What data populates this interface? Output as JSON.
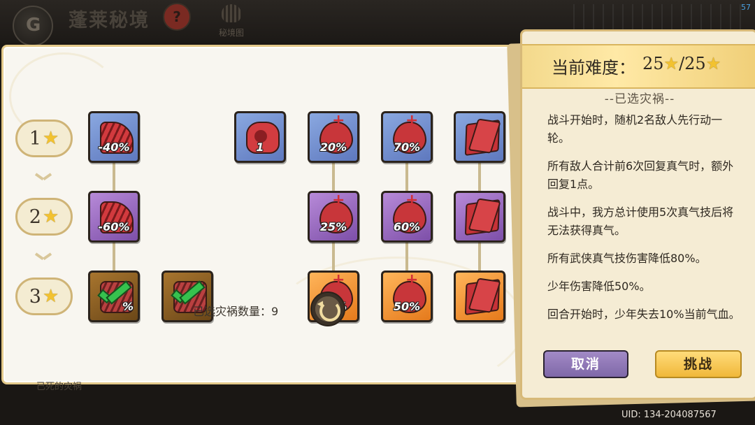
{
  "header": {
    "title": "蓬莱秘境",
    "map_label": "秘境图",
    "fps": "57"
  },
  "tiers": [
    {
      "label": "1",
      "star_icon": "star-icon"
    },
    {
      "label": "2",
      "star_icon": "star-icon"
    },
    {
      "label": "3",
      "star_icon": "star-icon"
    }
  ],
  "cards": {
    "t1_c1": {
      "value": "-40%",
      "color": "blue"
    },
    "t1_c3": {
      "value": "1",
      "color": "blue"
    },
    "t1_c4": {
      "value": "20%",
      "color": "blue"
    },
    "t1_c5": {
      "value": "70%",
      "color": "blue"
    },
    "t1_c6": {
      "value": "",
      "color": "blue"
    },
    "t2_c1": {
      "value": "-60%",
      "color": "purple"
    },
    "t2_c4": {
      "value": "25%",
      "color": "purple"
    },
    "t2_c5": {
      "value": "60%",
      "color": "purple"
    },
    "t2_c6": {
      "value": "",
      "color": "purple"
    },
    "t3_c1": {
      "value": "%",
      "color": "brown",
      "selected": true
    },
    "t3_c2": {
      "value": "",
      "color": "brown",
      "selected": true
    },
    "t3_c4": {
      "value": "30%",
      "color": "orange"
    },
    "t3_c5": {
      "value": "50%",
      "color": "orange"
    },
    "t3_c6": {
      "value": "",
      "color": "orange"
    }
  },
  "footer": {
    "count_label": "已选灾祸数量：",
    "count_value": "9",
    "under_text": "已死的灾祸"
  },
  "side_panel": {
    "difficulty_label": "当前难度：",
    "difficulty_current": "25",
    "difficulty_max": "25",
    "section_title": "--已选灾祸--",
    "effects": [
      "战斗开始时，随机2名敌人先行动一轮。",
      "所有敌人合计前6次回复真气时，额外回复1点。",
      "战斗中，我方总计使用5次真气技后将无法获得真气。",
      "所有武侠真气技伤害降低80%。",
      "少年伤害降低50%。",
      "回合开始时，少年失去10%当前气血。"
    ],
    "cancel_label": "取消",
    "challenge_label": "挑战"
  },
  "uid": "UID: 134-204087567",
  "colors": {
    "blue": "#7090d0",
    "purple": "#9a6ac0",
    "orange": "#f5962e",
    "brown": "#8a5e24",
    "gold": "#f2c230"
  }
}
